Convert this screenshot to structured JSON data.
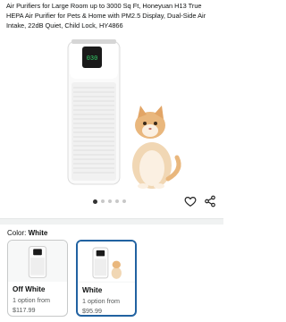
{
  "product": {
    "title": "Air Purifiers for Large Room up to 3000 Sq Ft, Honeyuan H13 True HEPA Air Purifier for Pets & Home with PM2.5 Display, Dual-Side Air Intake, 22dB Quiet, Child Lock, HY4866",
    "display_reading": "030",
    "image_count": 5,
    "active_image_index": 0
  },
  "icons": {
    "wishlist": "heart-icon",
    "share": "share-icon"
  },
  "variations": {
    "label": "Color:",
    "selected_value": "White",
    "options": [
      {
        "name": "Off White",
        "availability": "1 option from",
        "price": "$117.99",
        "selected": false
      },
      {
        "name": "White",
        "availability": "1 option from",
        "price": "$95.99",
        "selected": true
      }
    ]
  },
  "colors": {
    "accent_border": "#2162a1",
    "display_green": "#34d36b"
  }
}
